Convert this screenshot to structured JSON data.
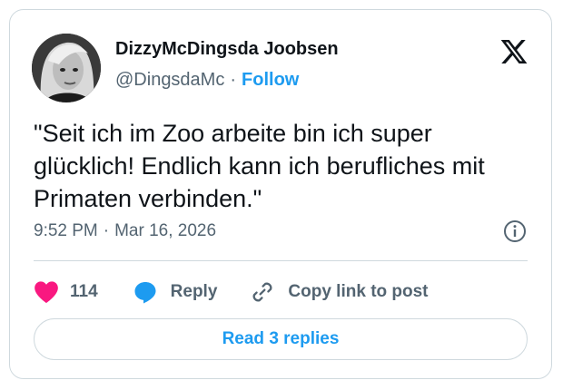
{
  "author": {
    "display_name": "DizzyMcDingsda Joobsen",
    "handle": "@DingsdaMc",
    "separator": "·",
    "follow_label": "Follow",
    "avatar_icon": "profile-photo"
  },
  "brand": {
    "logo_icon": "x-logo-icon"
  },
  "tweet": {
    "text": "\"Seit ich im Zoo arbeite bin ich super glücklich! Endlich kann ich berufliches mit Primaten verbinden.\"",
    "time": "9:52 PM",
    "separator": "·",
    "date": "Mar 16, 2026"
  },
  "actions": {
    "like_count": "114",
    "reply_label": "Reply",
    "copy_link_label": "Copy link to post"
  },
  "read_replies_label": "Read 3 replies",
  "colors": {
    "accent": "#1d9bf0",
    "like": "#f91880",
    "text": "#0f1419",
    "muted": "#536471",
    "border": "#cfd9de"
  }
}
